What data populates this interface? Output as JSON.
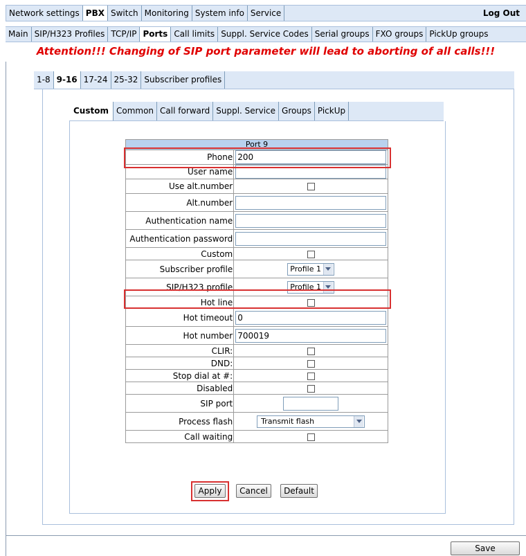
{
  "top_nav": {
    "tabs": [
      "Network settings",
      "PBX",
      "Switch",
      "Monitoring",
      "System info",
      "Service"
    ],
    "active": "PBX",
    "logout": "Log Out"
  },
  "sub_nav": {
    "tabs": [
      "Main",
      "SIP/H323 Profiles",
      "TCP/IP",
      "Ports",
      "Call limits",
      "Suppl. Service Codes",
      "Serial groups",
      "FXO groups",
      "PickUp groups"
    ],
    "active": "Ports"
  },
  "warning": "Attention!!! Changing of SIP port parameter will lead to aborting of all calls!!!",
  "port_groups": {
    "tabs": [
      "1-8",
      "9-16",
      "17-24",
      "25-32",
      "Subscriber profiles"
    ],
    "active": "9-16"
  },
  "inner_tabs": {
    "tabs": [
      "Custom",
      "Common",
      "Call forward",
      "Suppl. Service",
      "Groups",
      "PickUp"
    ],
    "active": "Custom"
  },
  "port_form": {
    "title": "Port 9",
    "fields": {
      "phone": {
        "label": "Phone",
        "value": "200"
      },
      "user_name": {
        "label": "User name",
        "value": ""
      },
      "use_alt_number": {
        "label": "Use alt.number",
        "checked": false
      },
      "alt_number": {
        "label": "Alt.number",
        "value": ""
      },
      "auth_name": {
        "label": "Authentication name",
        "value": ""
      },
      "auth_password": {
        "label": "Authentication password",
        "value": ""
      },
      "custom": {
        "label": "Custom",
        "checked": false
      },
      "subscriber_profile": {
        "label": "Subscriber profile",
        "value": "Profile 1"
      },
      "sip_profile": {
        "label": "SIP/H323 profile",
        "value": "Profile 1"
      },
      "hot_line": {
        "label": "Hot line",
        "checked": false
      },
      "hot_timeout": {
        "label": "Hot timeout",
        "value": "0"
      },
      "hot_number": {
        "label": "Hot number",
        "value": "700019"
      },
      "clir": {
        "label": "CLIR:",
        "checked": false
      },
      "dnd": {
        "label": "DND:",
        "checked": false
      },
      "stop_dial": {
        "label": "Stop dial at #:",
        "checked": false
      },
      "disabled": {
        "label": "Disabled",
        "checked": false
      },
      "sip_port": {
        "label": "SIP port",
        "value": ""
      },
      "process_flash": {
        "label": "Process flash",
        "value": "Transmit flash"
      },
      "call_waiting": {
        "label": "Call waiting",
        "checked": false
      }
    }
  },
  "buttons": {
    "apply": "Apply",
    "cancel": "Cancel",
    "default": "Default",
    "save": "Save"
  },
  "colors": {
    "tab_bar": "#dde8f6",
    "table_header": "#b9d2ef",
    "warning": "#e00000",
    "highlight": "#d83030"
  }
}
